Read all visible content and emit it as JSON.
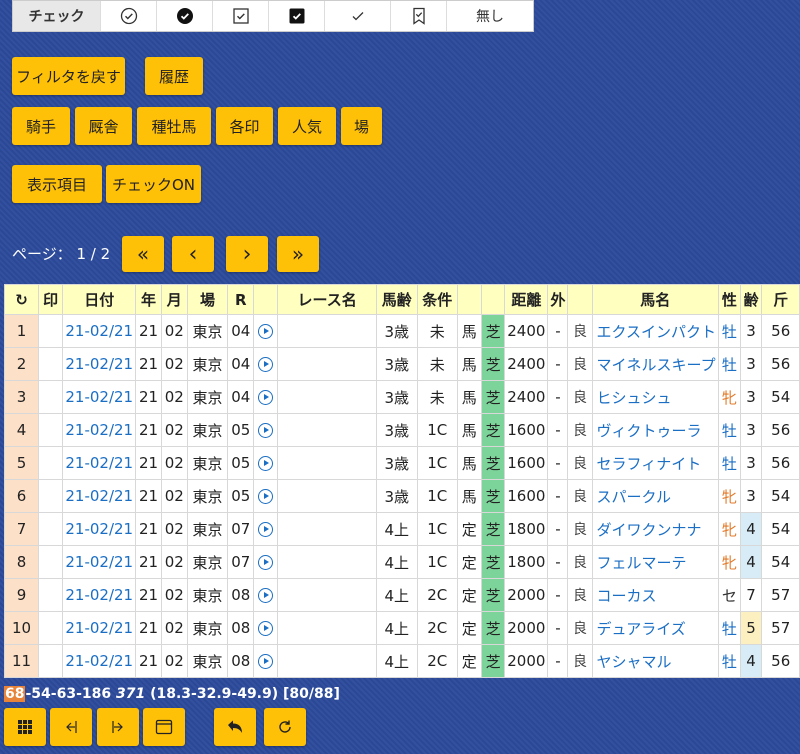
{
  "check_bar": {
    "label": "チェック",
    "options": [
      "circle-check-icon",
      "filled-circle-check-icon",
      "square-check-icon",
      "filled-square-check-icon",
      "check-icon",
      "bookmark-check-icon"
    ],
    "none_label": "無し"
  },
  "buttons": {
    "reset_filter": "フィルタを戻す",
    "history": "履歴",
    "jockey": "騎手",
    "stable": "厩舎",
    "sire": "種牡馬",
    "marks": "各印",
    "popularity": "人気",
    "venue": "場",
    "display_items": "表示項目",
    "check_on": "チェックON"
  },
  "pager": {
    "label": "ページ：",
    "current": "1 / 2",
    "first": "«",
    "prev": "‹",
    "next": "›",
    "last": "»"
  },
  "table": {
    "headers": {
      "refresh": "↻",
      "mark": "印",
      "date": "日付",
      "year": "年",
      "month": "月",
      "venue": "場",
      "race": "R",
      "play": "",
      "race_name": "レース名",
      "age_cond": "馬齢",
      "condition": "条件",
      "blank1": "",
      "blank2": "",
      "distance": "距離",
      "outer": "外",
      "blank3": "",
      "horse": "馬名",
      "sex": "性",
      "age": "齢",
      "weight": "斤"
    },
    "rows": [
      {
        "n": "1",
        "date": "21-02/21",
        "y": "21",
        "m": "02",
        "venue": "東京",
        "r": "04",
        "agec": "3歳",
        "cond": "未",
        "kind": "馬",
        "surf": "芝",
        "dist": "2400",
        "out": "-",
        "going": "良",
        "horse": "エクスインパクト",
        "sex": "牡",
        "age": "3",
        "w": "56"
      },
      {
        "n": "2",
        "date": "21-02/21",
        "y": "21",
        "m": "02",
        "venue": "東京",
        "r": "04",
        "agec": "3歳",
        "cond": "未",
        "kind": "馬",
        "surf": "芝",
        "dist": "2400",
        "out": "-",
        "going": "良",
        "horse": "マイネルスキープ",
        "sex": "牡",
        "age": "3",
        "w": "56"
      },
      {
        "n": "3",
        "date": "21-02/21",
        "y": "21",
        "m": "02",
        "venue": "東京",
        "r": "04",
        "agec": "3歳",
        "cond": "未",
        "kind": "馬",
        "surf": "芝",
        "dist": "2400",
        "out": "-",
        "going": "良",
        "horse": "ヒシュシュ",
        "sex": "牝",
        "age": "3",
        "w": "54"
      },
      {
        "n": "4",
        "date": "21-02/21",
        "y": "21",
        "m": "02",
        "venue": "東京",
        "r": "05",
        "agec": "3歳",
        "cond": "1C",
        "kind": "馬",
        "surf": "芝",
        "dist": "1600",
        "out": "-",
        "going": "良",
        "horse": "ヴィクトゥーラ",
        "sex": "牡",
        "age": "3",
        "w": "56"
      },
      {
        "n": "5",
        "date": "21-02/21",
        "y": "21",
        "m": "02",
        "venue": "東京",
        "r": "05",
        "agec": "3歳",
        "cond": "1C",
        "kind": "馬",
        "surf": "芝",
        "dist": "1600",
        "out": "-",
        "going": "良",
        "horse": "セラフィナイト",
        "sex": "牡",
        "age": "3",
        "w": "56"
      },
      {
        "n": "6",
        "date": "21-02/21",
        "y": "21",
        "m": "02",
        "venue": "東京",
        "r": "05",
        "agec": "3歳",
        "cond": "1C",
        "kind": "馬",
        "surf": "芝",
        "dist": "1600",
        "out": "-",
        "going": "良",
        "horse": "スパークル",
        "sex": "牝",
        "age": "3",
        "w": "54"
      },
      {
        "n": "7",
        "date": "21-02/21",
        "y": "21",
        "m": "02",
        "venue": "東京",
        "r": "07",
        "agec": "4上",
        "cond": "1C",
        "kind": "定",
        "surf": "芝",
        "dist": "1800",
        "out": "-",
        "going": "良",
        "horse": "ダイワクンナナ",
        "sex": "牝",
        "age": "4",
        "w": "54"
      },
      {
        "n": "8",
        "date": "21-02/21",
        "y": "21",
        "m": "02",
        "venue": "東京",
        "r": "07",
        "agec": "4上",
        "cond": "1C",
        "kind": "定",
        "surf": "芝",
        "dist": "1800",
        "out": "-",
        "going": "良",
        "horse": "フェルマーテ",
        "sex": "牝",
        "age": "4",
        "w": "54"
      },
      {
        "n": "9",
        "date": "21-02/21",
        "y": "21",
        "m": "02",
        "venue": "東京",
        "r": "08",
        "agec": "4上",
        "cond": "2C",
        "kind": "定",
        "surf": "芝",
        "dist": "2000",
        "out": "-",
        "going": "良",
        "horse": "コーカス",
        "sex": "セ",
        "age": "7",
        "w": "57"
      },
      {
        "n": "10",
        "date": "21-02/21",
        "y": "21",
        "m": "02",
        "venue": "東京",
        "r": "08",
        "agec": "4上",
        "cond": "2C",
        "kind": "定",
        "surf": "芝",
        "dist": "2000",
        "out": "-",
        "going": "良",
        "horse": "デュアライズ",
        "sex": "牡",
        "age": "5",
        "w": "57"
      },
      {
        "n": "11",
        "date": "21-02/21",
        "y": "21",
        "m": "02",
        "venue": "東京",
        "r": "08",
        "agec": "4上",
        "cond": "2C",
        "kind": "定",
        "surf": "芝",
        "dist": "2000",
        "out": "-",
        "going": "良",
        "horse": "ヤシャマル",
        "sex": "牡",
        "age": "4",
        "w": "56"
      }
    ]
  },
  "stats": {
    "highlight": "68",
    "rest": "-54-63-186 ",
    "italic": "371",
    "detail": " (18.3-32.9-49.9) [80/88]"
  },
  "bottom_toolbar": [
    "grid-icon",
    "collapse-left-icon",
    "expand-right-icon",
    "window-icon",
    "back-arrow-icon",
    "refresh-icon"
  ]
}
